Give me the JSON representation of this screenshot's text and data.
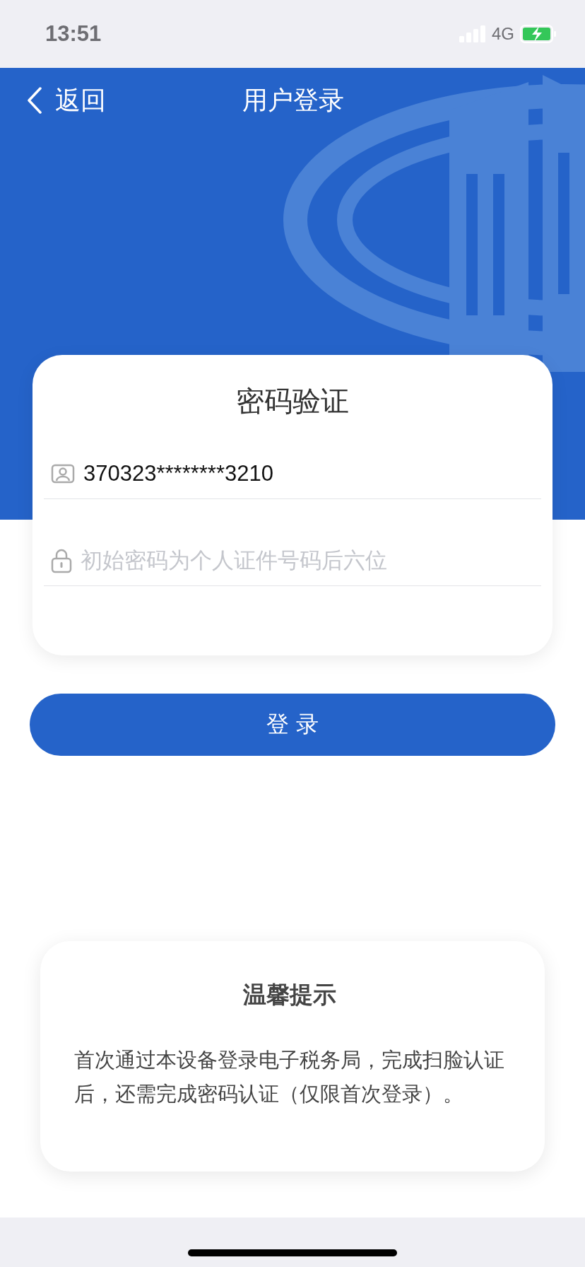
{
  "status_bar": {
    "time": "13:51",
    "network": "4G"
  },
  "nav": {
    "back": "返回",
    "title": "用户登录"
  },
  "login_card": {
    "title": "密码验证",
    "id_field": {
      "value": "370323********3210"
    },
    "password_field": {
      "placeholder": "初始密码为个人证件号码后六位"
    }
  },
  "login_button": "登 录",
  "tip": {
    "title": "温馨提示",
    "text": "首次通过本设备登录电子税务局，完成扫脸认证后，还需完成密码认证（仅限首次登录）。"
  }
}
